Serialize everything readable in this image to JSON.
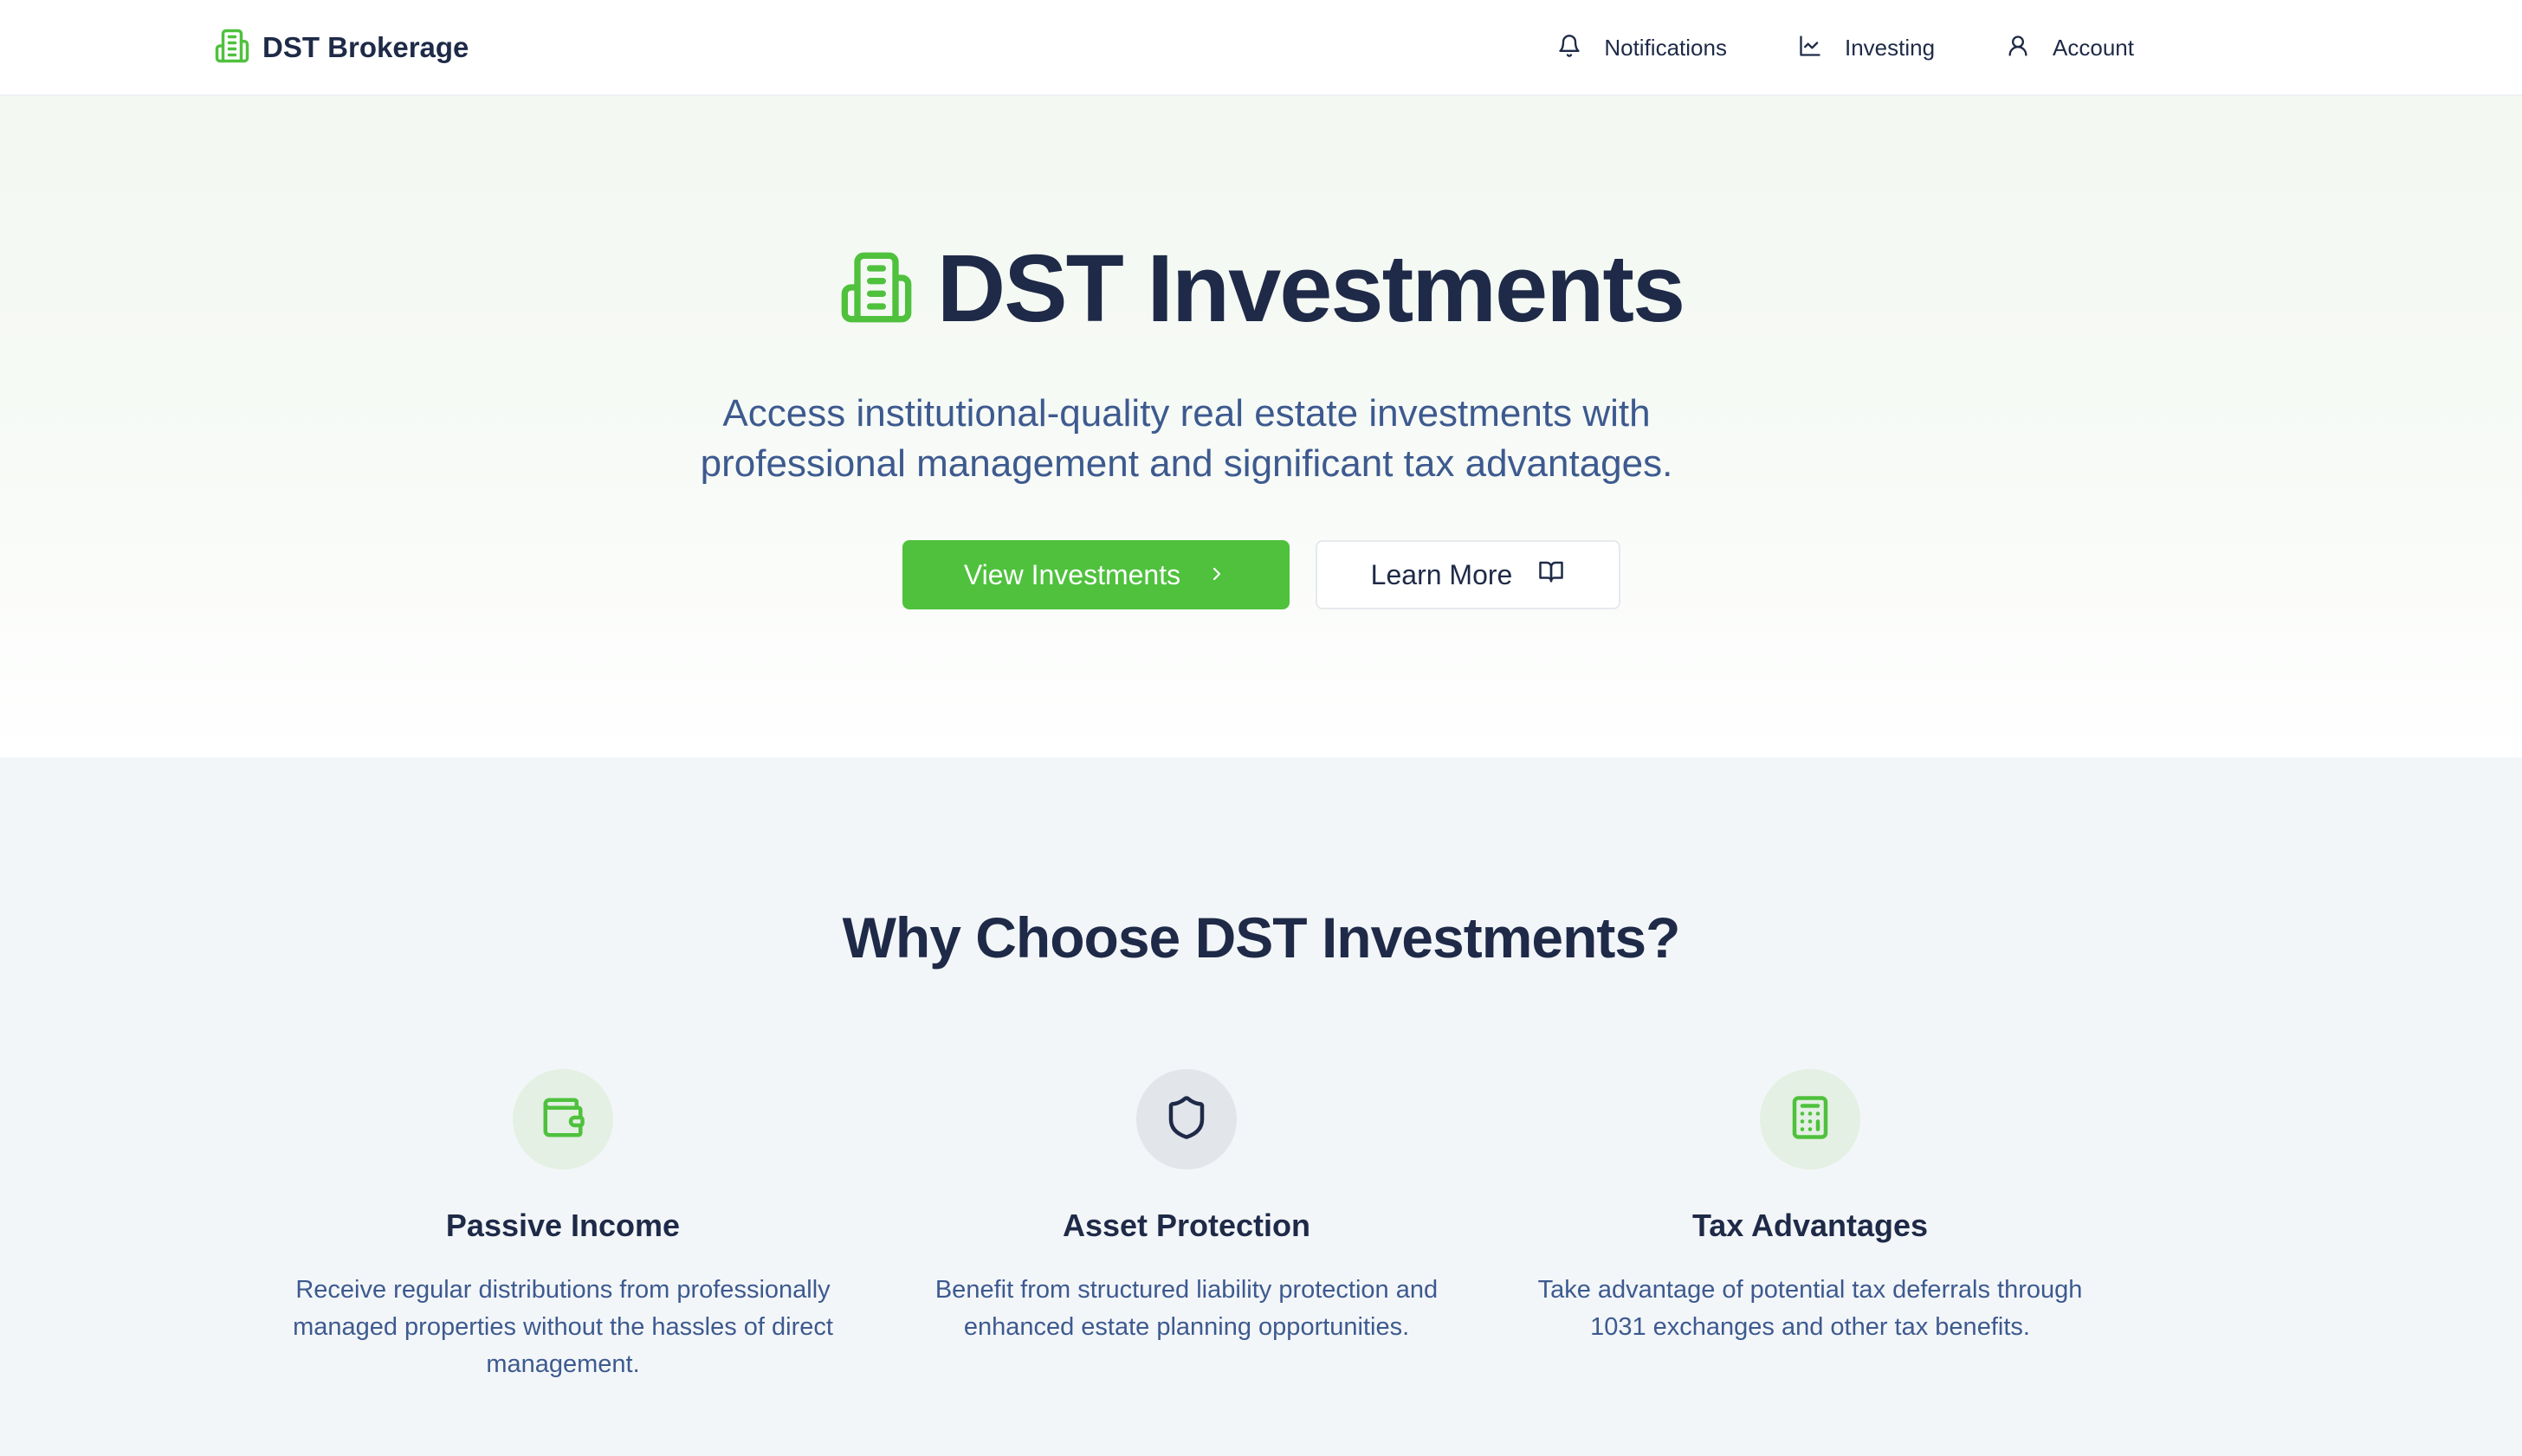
{
  "nav": {
    "brand": "DST Brokerage",
    "brand_icon": "building-icon",
    "links": [
      {
        "label": "Notifications",
        "icon": "bell-icon"
      },
      {
        "label": "Investing",
        "icon": "chart-line-icon"
      },
      {
        "label": "Account",
        "icon": "user-icon"
      }
    ]
  },
  "hero": {
    "title": "DST Investments",
    "title_icon": "building-icon",
    "subtitle": "Access institutional-quality real estate investments with professional management and significant tax advantages.",
    "primary_button": "View Investments",
    "secondary_button": "Learn More"
  },
  "features": {
    "heading": "Why Choose DST Investments?",
    "items": [
      {
        "title": "Passive Income",
        "icon": "wallet-icon",
        "description": "Receive regular distributions from professionally managed properties without the hassles of direct management."
      },
      {
        "title": "Asset Protection",
        "icon": "shield-icon",
        "description": "Benefit from structured liability protection and enhanced estate planning opportunities."
      },
      {
        "title": "Tax Advantages",
        "icon": "calculator-icon",
        "description": "Take advantage of potential tax deferrals through 1031 exchanges and other tax benefits."
      }
    ]
  },
  "colors": {
    "accent": "#4fc13d",
    "text_dark": "#1e2a47",
    "text_muted": "#3d5a8f",
    "section_bg": "#f3f6f9"
  }
}
